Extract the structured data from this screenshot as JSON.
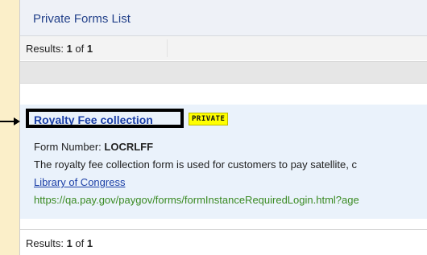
{
  "panel": {
    "title": "Private Forms List",
    "results_top": {
      "prefix": "Results: ",
      "current": "1",
      "sep": " of ",
      "total": "1"
    },
    "results_bottom": {
      "prefix": "Results: ",
      "current": "1",
      "sep": " of ",
      "total": "1"
    }
  },
  "form_item": {
    "name": "Royalty Fee collection",
    "badge": "PRIVATE",
    "form_number_label": "Form Number: ",
    "form_number": "LOCRLFF",
    "description": "The royalty fee collection form is used for customers to pay satellite, c",
    "agency": "Library of Congress",
    "url": "https://qa.pay.gov/paygov/forms/formInstanceRequiredLogin.html?age"
  },
  "icons": {
    "arrow": "arrow-right-icon"
  }
}
